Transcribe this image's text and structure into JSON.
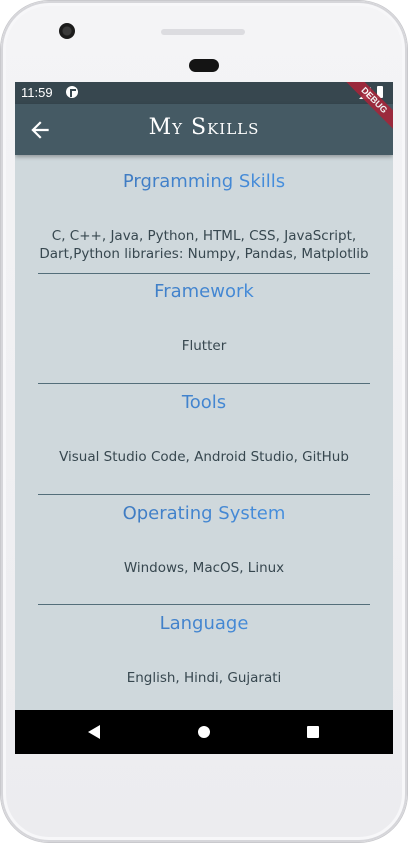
{
  "status_bar": {
    "time": "11:59",
    "icons": [
      "app-notification-icon",
      "signal-icon",
      "battery-icon"
    ]
  },
  "app_bar": {
    "title": "My Skills",
    "back_icon": "arrow-back-icon",
    "debug_banner": "DEBUG"
  },
  "sections": [
    {
      "heading": "Prgramming Skills",
      "body": "C, C++, Java, Python, HTML, CSS, JavaScript, Dart,Python libraries: Numpy, Pandas, Matplotlib"
    },
    {
      "heading": "Framework",
      "body": "Flutter"
    },
    {
      "heading": "Tools",
      "body": "Visual Studio Code, Android Studio, GitHub"
    },
    {
      "heading": "Operating System",
      "body": "Windows, MacOS, Linux"
    },
    {
      "heading": "Language",
      "body": "English, Hindi, Gujarati"
    }
  ],
  "nav_bar": {
    "buttons": [
      "nav-back-icon",
      "nav-home-icon",
      "nav-recents-icon"
    ]
  },
  "colors": {
    "status_bar": "#37474f",
    "app_bar": "#455a64",
    "background": "#cfd8dc",
    "heading_gradient_start": "#3b6fb0",
    "heading_gradient_end": "#4a9bf0",
    "body_text": "#37474f",
    "divider": "#546e7a"
  }
}
